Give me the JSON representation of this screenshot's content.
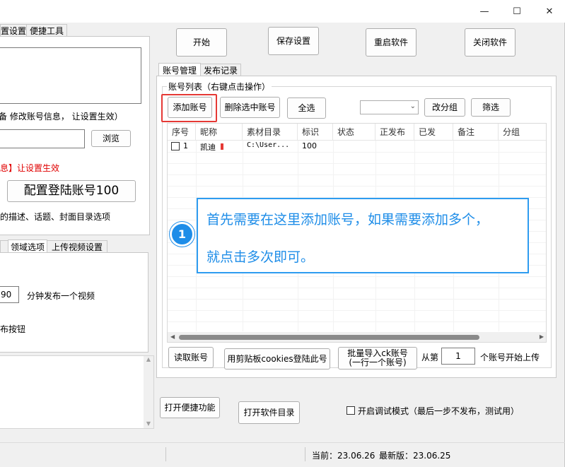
{
  "titlebar": {
    "minimize": "—",
    "maximize": "☐",
    "close": "✕"
  },
  "left": {
    "tabs": [
      "置设置",
      "便捷工具"
    ],
    "hint_text": "备 修改账号信息， 让设置生效）",
    "browse_button": "浏览",
    "red_text": "息】让设置生效",
    "config_button": "配置登陆账号100",
    "desc_text": "的描述、话题、封面目录选项",
    "sub_tabs": [
      "",
      "领域选项",
      "上传视频设置"
    ],
    "interval_value": "90",
    "interval_label": "分钟发布一个视频",
    "button_text": "布按钮"
  },
  "toolbar": {
    "start": "开始",
    "save": "保存设置",
    "restart": "重启软件",
    "close": "关闭软件"
  },
  "main_tabs": [
    "账号管理",
    "发布记录"
  ],
  "group": {
    "title": "账号列表（右键点击操作）",
    "add_button": "添加账号",
    "delete_button": "删除选中账号",
    "select_all_button": "全选",
    "group_select_value": "",
    "change_group_button": "改分组",
    "filter_button": "筛选"
  },
  "table": {
    "columns": [
      "序号",
      "昵称",
      "素材目录",
      "标识",
      "状态",
      "正发布",
      "已发",
      "备注",
      "分组"
    ],
    "rows": [
      {
        "index": "1",
        "nickname": "凯迪",
        "dir": "C:\\User...",
        "flag": "100",
        "status": "",
        "publishing": "",
        "sent": "",
        "note": "",
        "group": ""
      }
    ]
  },
  "callout": {
    "number": "1",
    "line1": "首先需要在这里添加账号，如果需要添加多个，",
    "line2": "就点击多次即可。"
  },
  "bottom": {
    "read_button": "读取账号",
    "clipboard_button": "用剪贴板cookies登陆此号",
    "batch_line1": "批量导入ck账号",
    "batch_line2": "(一行一个账号)",
    "from_label": "从第",
    "from_value": "1",
    "from_suffix": "个账号开始上传"
  },
  "footer": {
    "shortcut_button": "打开便捷功能",
    "open_dir_button": "打开软件目录",
    "debug_label": "开启调试模式（最后一步不发布，测试用）"
  },
  "status": {
    "current": "当前：23.06.26",
    "latest": "最新版：23.06.25"
  },
  "colors": {
    "accent": "#2e9cf0",
    "highlight": "#e53935",
    "red_text": "#e00000"
  }
}
